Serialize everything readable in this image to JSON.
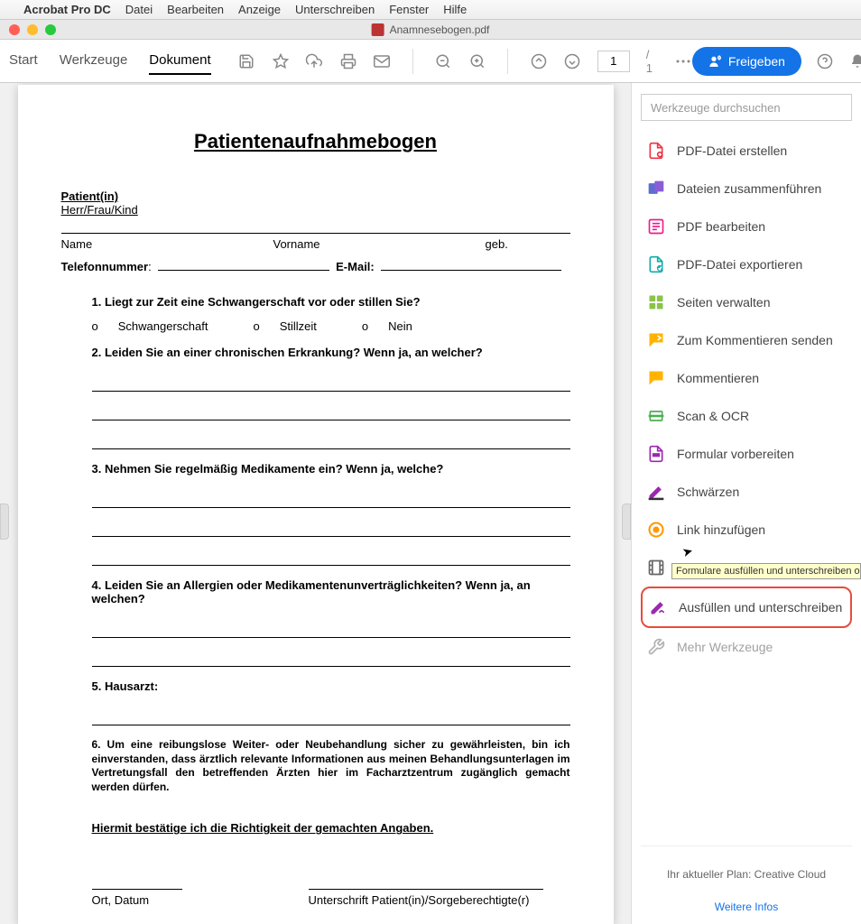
{
  "menubar": {
    "app": "Acrobat Pro DC",
    "items": [
      "Datei",
      "Bearbeiten",
      "Anzeige",
      "Unterschreiben",
      "Fenster",
      "Hilfe"
    ]
  },
  "titlebar": {
    "filename": "Anamnesebogen.pdf"
  },
  "toolbar": {
    "tabs": {
      "start": "Start",
      "tools": "Werkzeuge",
      "document": "Dokument"
    },
    "page_current": "1",
    "page_total": "/ 1",
    "share_label": "Freigeben"
  },
  "doc": {
    "title": "Patientenaufnahmebogen",
    "patient_label": "Patient(in)",
    "patient_sub": "Herr/Frau/Kind",
    "f_name": "Name",
    "f_vorname": "Vorname",
    "f_geb": "geb.",
    "f_tel": "Telefonnummer",
    "f_email": "E-Mail:",
    "q1": "1. Liegt zur Zeit eine Schwangerschaft vor oder stillen Sie?",
    "q1_o": "o",
    "q1_opt1": "Schwangerschaft",
    "q1_opt2": "Stillzeit",
    "q1_opt3": "Nein",
    "q2": "2. Leiden Sie an einer chronischen Erkrankung? Wenn ja, an welcher?",
    "q3": "3. Nehmen Sie regelmäßig Medikamente ein? Wenn ja, welche?",
    "q4": "4. Leiden Sie an Allergien oder Medikamentenunverträglichkeiten? Wenn ja, an welchen?",
    "q5": "5. Hausarzt:",
    "q6": "6. Um eine reibungslose Weiter- oder Neubehandlung sicher zu gewährleisten, bin ich einverstanden, dass ärztlich relevante Informationen aus meinen Behandlungsunterlagen im Vertretungsfall den betreffenden Ärzten hier im Facharztzentrum zugänglich gemacht werden dürfen.",
    "confirm": "Hiermit bestätige ich die Richtigkeit der gemachten Angaben.",
    "sign_place": "Ort, Datum",
    "sign_sig": "Unterschrift Patient(in)/Sorgeberechtigte(r)"
  },
  "rpanel": {
    "search_placeholder": "Werkzeuge durchsuchen",
    "tools": {
      "create": "PDF-Datei erstellen",
      "combine": "Dateien zusammenführen",
      "edit": "PDF bearbeiten",
      "export": "PDF-Datei exportieren",
      "pages": "Seiten verwalten",
      "sendcomment": "Zum Kommentieren senden",
      "comment": "Kommentieren",
      "scan": "Scan & OCR",
      "form": "Formular vorbereiten",
      "redact": "Schwärzen",
      "link": "Link hinzufügen",
      "media": "Rich Media",
      "fillsign": "Ausfüllen und unterschreiben",
      "more": "Mehr Werkzeuge"
    },
    "tooltip": "Formulare ausfüllen und unterschreiben oder von a",
    "plan": "Ihr aktueller Plan: Creative Cloud",
    "more_info": "Weitere Infos"
  }
}
